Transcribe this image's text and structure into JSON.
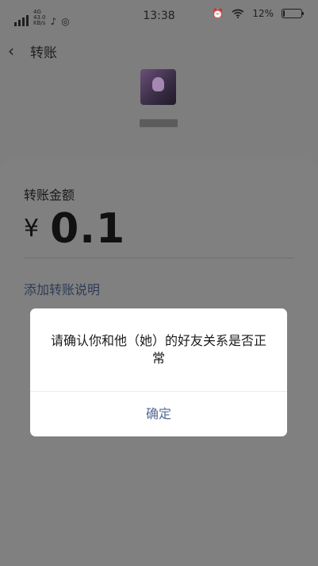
{
  "status_bar": {
    "network": "4G",
    "speed_value": "43.0",
    "speed_unit": "KB/s",
    "time": "13:38",
    "battery": "12%",
    "icons": [
      "signal-icon",
      "tiktok-icon",
      "wechat-icon",
      "alarm-icon",
      "wifi-icon",
      "battery-icon"
    ]
  },
  "header": {
    "title": "转账",
    "back_icon": "chevron-left-icon"
  },
  "payee": {
    "avatar": "avatar-image"
  },
  "transfer": {
    "amount_label": "转账金额",
    "currency_symbol": "¥",
    "amount": "0.1",
    "add_note": "添加转账说明"
  },
  "dialog": {
    "message": "请确认你和他（她）的好友关系是否正常",
    "confirm_label": "确定"
  }
}
